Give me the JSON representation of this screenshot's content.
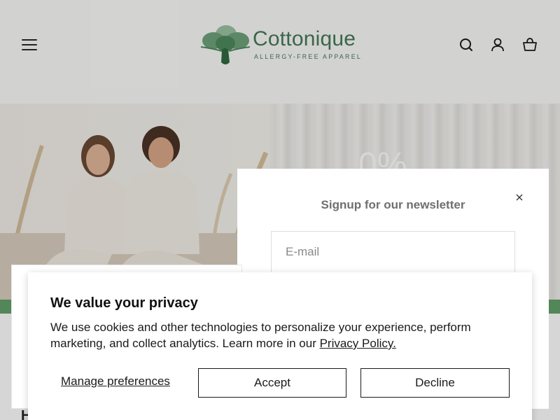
{
  "header": {
    "brand_name": "Cottonique",
    "brand_tagline": "ALLERGY-FREE APPAREL",
    "brand_green": "#467a58",
    "icons": [
      "menu-icon",
      "search-icon",
      "account-icon",
      "cart-icon"
    ]
  },
  "hero": {
    "promo_text": "0%"
  },
  "newsletter": {
    "title": "Signup for our newsletter",
    "email_placeholder": "E-mail",
    "email_value": "",
    "close_icon": "close-icon"
  },
  "privacy": {
    "title": "We value your privacy",
    "body": "We use cookies and other technologies to personalize your experience, perform marketing, and collect analytics. Learn more in our ",
    "policy_link": "Privacy Policy.",
    "manage_label": "Manage preferences",
    "accept_label": "Accept",
    "decline_label": "Decline"
  },
  "page": {
    "cut_heading": "H"
  },
  "colors": {
    "green_strip": "#64a06b",
    "text_dark": "#1a1a1a"
  }
}
